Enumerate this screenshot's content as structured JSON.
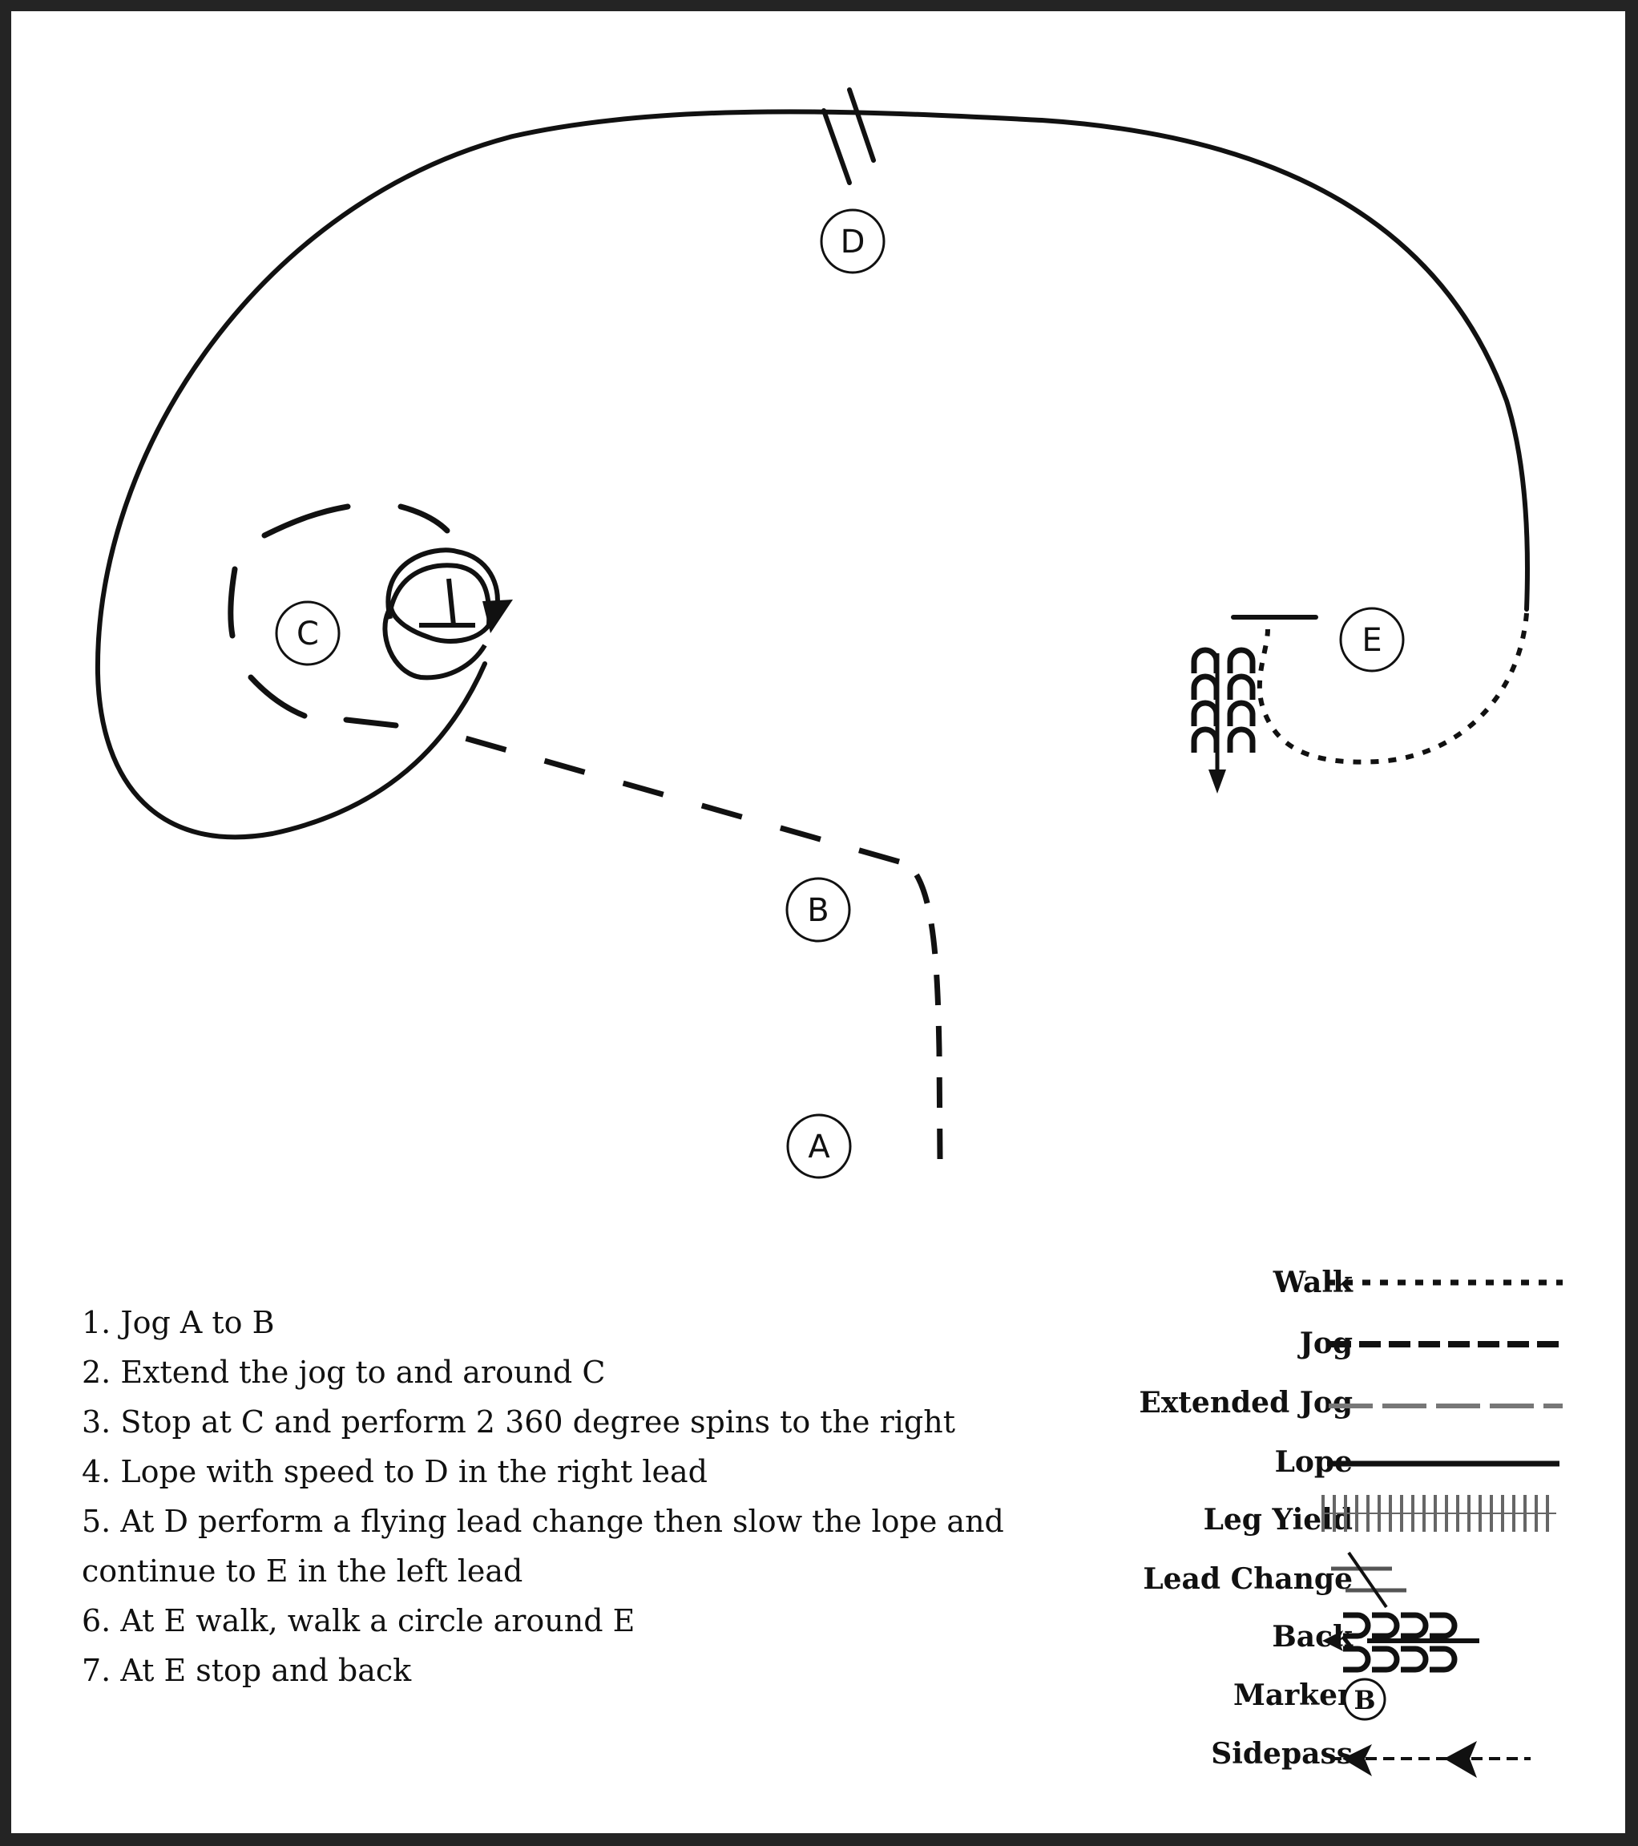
{
  "pattern": {
    "markers": [
      {
        "id": "A",
        "label": "A"
      },
      {
        "id": "B",
        "label": "B"
      },
      {
        "id": "C",
        "label": "C"
      },
      {
        "id": "D",
        "label": "D"
      },
      {
        "id": "E",
        "label": "E"
      }
    ],
    "segments": [
      {
        "from": "A",
        "to": "B",
        "gait": "Jog"
      },
      {
        "from": "B",
        "to": "C",
        "gait": "Extended Jog",
        "note": "around C"
      },
      {
        "at": "C",
        "maneuver": "2 x 360 degree spins to the right"
      },
      {
        "from": "C",
        "to": "D",
        "gait": "Lope",
        "lead": "right"
      },
      {
        "at": "D",
        "maneuver": "Lead Change"
      },
      {
        "from": "D",
        "to": "E",
        "gait": "Lope",
        "lead": "left"
      },
      {
        "at": "E",
        "gait": "Walk",
        "note": "circle around E"
      },
      {
        "at": "E",
        "maneuver": "Back"
      }
    ]
  },
  "instructions": [
    "1. Jog A to B",
    "2. Extend the jog to and around C",
    "3. Stop at C and perform 2 360 degree spins to the right",
    "4.  Lope with speed to D in the right lead",
    "5. At D perform a flying lead change then slow the lope and continue to E in the left lead",
    "6. At E walk, walk a circle around E",
    "7. At E stop and back"
  ],
  "legend": [
    {
      "label": "Walk",
      "symbol": "dotted-line"
    },
    {
      "label": "Jog",
      "symbol": "dashed-line"
    },
    {
      "label": "Extended Jog",
      "symbol": "long-dashed-gray-line"
    },
    {
      "label": "Lope",
      "symbol": "solid-line"
    },
    {
      "label": "Leg Yield",
      "symbol": "hatched-line"
    },
    {
      "label": "Lead Change",
      "symbol": "lead-change-mark"
    },
    {
      "label": "Back",
      "symbol": "back-arrow"
    },
    {
      "label": "Marker",
      "symbol": "marker-circle",
      "sample": "B"
    },
    {
      "label": "Sidepass",
      "symbol": "sidepass-arrow"
    }
  ],
  "colors": {
    "frame": "#242424",
    "background": "#ffffff",
    "ink": "#111111",
    "extended_jog": "#777777"
  }
}
